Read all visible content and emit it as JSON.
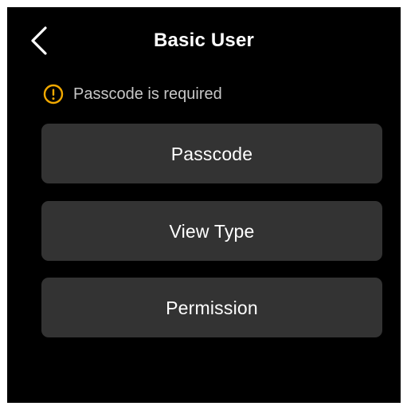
{
  "header": {
    "back_icon": "chevron-left-icon",
    "title": "Basic User"
  },
  "warning": {
    "icon": "warning-circle-icon",
    "message": "Passcode is required",
    "color": "#f2a900"
  },
  "buttons": [
    {
      "label": "Passcode"
    },
    {
      "label": "View Type"
    },
    {
      "label": "Permission"
    }
  ],
  "colors": {
    "background": "#000000",
    "button": "#333333",
    "text": "#ffffff",
    "warning_text": "#c7c7c7"
  }
}
